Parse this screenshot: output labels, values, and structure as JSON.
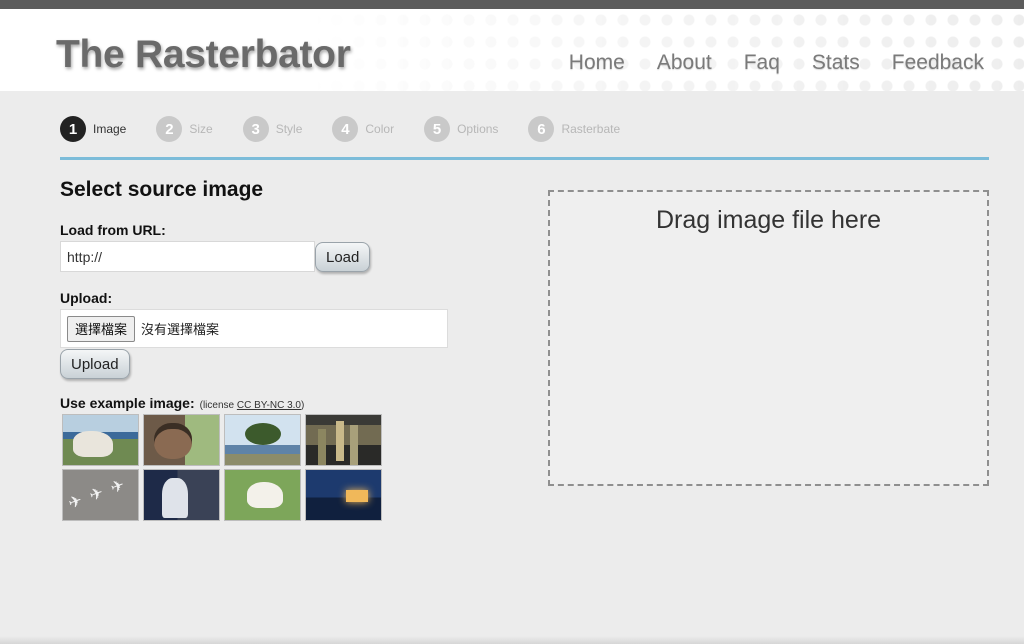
{
  "header": {
    "site_title": "The Rasterbator",
    "nav": [
      "Home",
      "About",
      "Faq",
      "Stats",
      "Feedback"
    ]
  },
  "steps": [
    {
      "num": "1",
      "label": "Image",
      "active": true
    },
    {
      "num": "2",
      "label": "Size",
      "active": false
    },
    {
      "num": "3",
      "label": "Style",
      "active": false
    },
    {
      "num": "4",
      "label": "Color",
      "active": false
    },
    {
      "num": "5",
      "label": "Options",
      "active": false
    },
    {
      "num": "6",
      "label": "Rasterbate",
      "active": false
    }
  ],
  "main": {
    "section_title": "Select source image",
    "url_label": "Load from URL:",
    "url_value": "http://",
    "load_button": "Load",
    "upload_label": "Upload:",
    "file_button": "選擇檔案",
    "file_status": "沒有選擇檔案",
    "upload_button": "Upload",
    "example_label": "Use example image:",
    "license_prefix": "(license ",
    "license_link": "CC BY-NC 3.0",
    "license_suffix": ")",
    "example_thumbnails": [
      "cow",
      "man with hat",
      "tree by lake",
      "city at night",
      "airplanes",
      "statue",
      "white sheep",
      "lit house at dusk"
    ],
    "dropzone_text": "Drag image file here"
  },
  "colors": {
    "accent_line": "#7cbcd9",
    "active_step": "#222222",
    "inactive_step": "#c9c9c9"
  }
}
